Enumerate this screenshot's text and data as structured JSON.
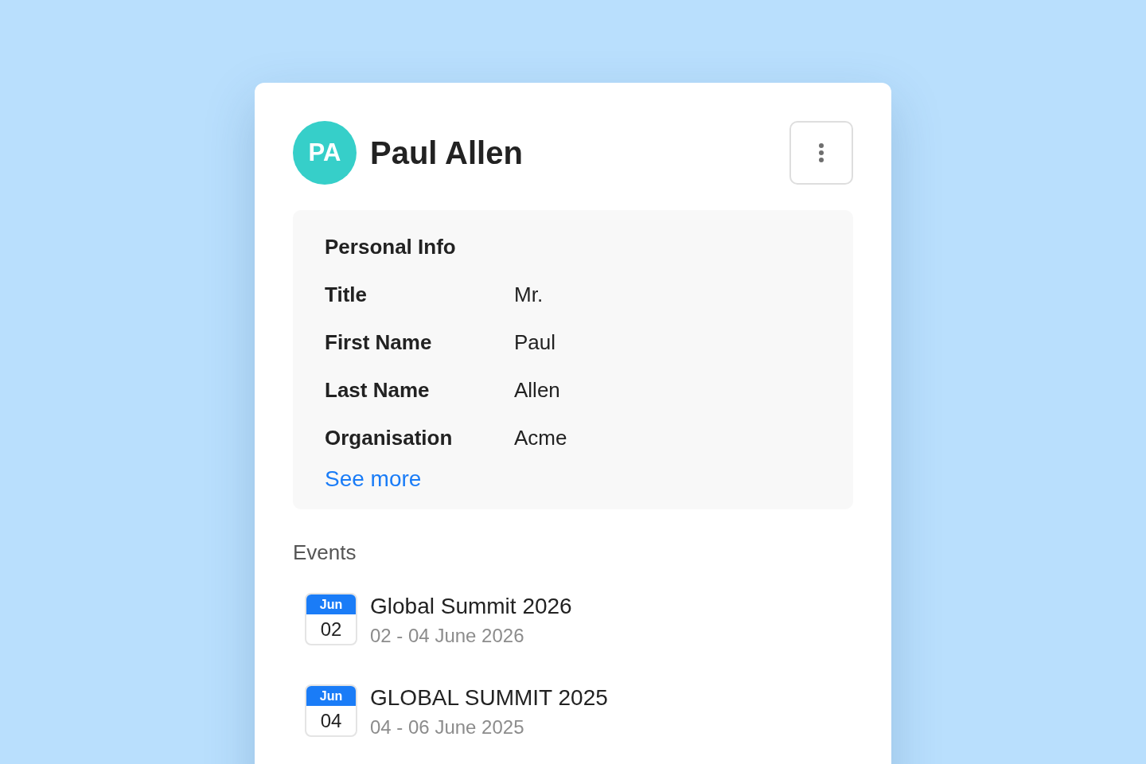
{
  "contact": {
    "initials": "PA",
    "name": "Paul Allen"
  },
  "personal_info": {
    "heading": "Personal Info",
    "fields": [
      {
        "label": "Title",
        "value": "Mr."
      },
      {
        "label": "First Name",
        "value": "Paul"
      },
      {
        "label": "Last Name",
        "value": "Allen"
      },
      {
        "label": "Organisation",
        "value": "Acme"
      }
    ],
    "link": "See more"
  },
  "events": {
    "heading": "Events",
    "items": [
      {
        "month": "Jun",
        "day": "02",
        "title": "Global Summit 2026",
        "dates": "02 - 04 June 2026"
      },
      {
        "month": "Jun",
        "day": "04",
        "title": "GLOBAL SUMMIT 2025",
        "dates": "04 - 06 June 2025"
      }
    ]
  }
}
